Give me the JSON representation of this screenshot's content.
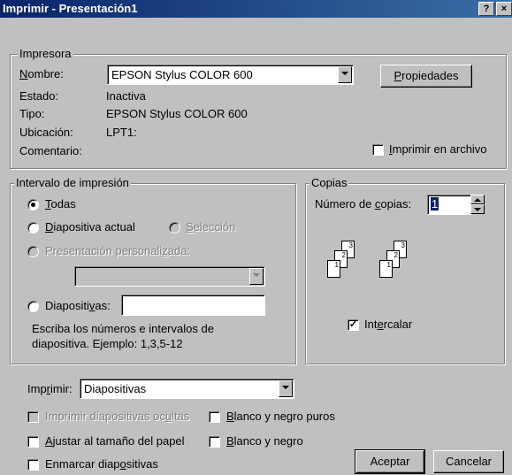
{
  "window": {
    "title": "Imprimir - Presentación1",
    "help_glyph": "?",
    "close_glyph": "×"
  },
  "printer": {
    "legend": "Impresora",
    "name_label_u": "N",
    "name_label_rest": "ombre:",
    "name_value": "EPSON Stylus COLOR 600",
    "properties_u": "P",
    "properties_rest": "ropiedades",
    "status_label": "Estado:",
    "status_value": "Inactiva",
    "type_label": "Tipo:",
    "type_value": "EPSON Stylus COLOR 600",
    "location_label": "Ubicación:",
    "location_value": "LPT1:",
    "comment_label": "Comentario:",
    "print_to_file_u": "I",
    "print_to_file_rest": "mprimir en archivo",
    "print_to_file_checked": false
  },
  "range": {
    "legend": "Intervalo de impresión",
    "all_u": "T",
    "all_rest": "odas",
    "all_selected": true,
    "current_u": "D",
    "current_rest": "iapositiva actual",
    "selection_u": "S",
    "selection_rest": "elección",
    "custom_pre": "Presentación personali",
    "custom_u": "z",
    "custom_post": "ada:",
    "slides_pre": "Diapositi",
    "slides_u": "v",
    "slides_post": "as:",
    "hint_line1": "Escriba los números e intervalos de",
    "hint_line2": "diapositiva. Ejemplo: 1,3,5-12"
  },
  "copies": {
    "legend": "Copias",
    "count_pre": "Número de ",
    "count_u": "c",
    "count_post": "opias:",
    "count_value": "1",
    "collate_pre": "Int",
    "collate_u": "e",
    "collate_post": "rcalar",
    "collate_checked": true,
    "stack_pages": [
      "1",
      "2",
      "3"
    ]
  },
  "print_what": {
    "label_pre": "Imp",
    "label_u": "r",
    "label_post": "imir:",
    "value": "Diapositivas"
  },
  "options": {
    "hidden_pre": "Imprimir diapositivas oc",
    "hidden_u": "u",
    "hidden_post": "ltas",
    "pure_bw_u": "B",
    "pure_bw_rest": "lanco y negro puros",
    "fit_u": "A",
    "fit_rest": "justar al tamaño del papel",
    "bw_u": "B",
    "bw_rest": "lanco y negro",
    "frame_pre": "Enmarcar diap",
    "frame_u": "o",
    "frame_post": "sitivas"
  },
  "buttons": {
    "ok": "Aceptar",
    "cancel": "Cancelar"
  }
}
